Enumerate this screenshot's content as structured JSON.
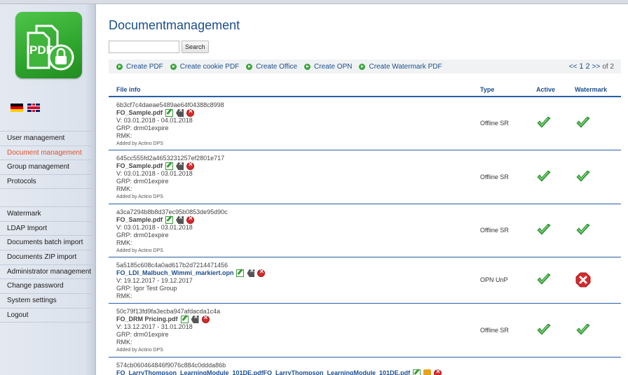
{
  "window": {
    "title": "Documentmanagement"
  },
  "sidebar": {
    "menu1": [
      {
        "label": "User management",
        "active": false
      },
      {
        "label": "Document management",
        "active": true
      },
      {
        "label": "Group management",
        "active": false
      },
      {
        "label": "Protocols",
        "active": false
      }
    ],
    "menu2": [
      {
        "label": "Watermark"
      },
      {
        "label": "LDAP Import"
      },
      {
        "label": "Documents batch import"
      },
      {
        "label": "Documents ZIP import"
      },
      {
        "label": "Administrator management"
      },
      {
        "label": "Change password"
      },
      {
        "label": "System settings"
      },
      {
        "label": "Logout"
      }
    ],
    "logo_text": "PDF"
  },
  "search": {
    "value": "",
    "button_label": "Search"
  },
  "actions": [
    {
      "label": "Create PDF"
    },
    {
      "label": "Create cookie PDF"
    },
    {
      "label": "Create Office"
    },
    {
      "label": "Create OPN"
    },
    {
      "label": "Create Watermark PDF"
    }
  ],
  "pager": {
    "prev": "<<",
    "pages": [
      "1",
      "2"
    ],
    "next": ">>",
    "of": "of 2"
  },
  "table": {
    "headers": {
      "info": "File info",
      "type": "Type",
      "active": "Active",
      "watermark": "Watermark"
    },
    "rows": [
      {
        "hash": "6b3cf7c4daeae5489ae64f04388c8998",
        "filename": "FO_Sample.pdf",
        "validity": "V: 03.01.2018 - 04.01.2018",
        "group": "GRP: drm01expire",
        "remark": "RMK:",
        "added": "Added by Actino DPS",
        "type": "Offline SR",
        "active": true,
        "watermark": true
      },
      {
        "hash": "645cc555fd2a4653231257ef2801e717",
        "filename": "FO_Sample.pdf",
        "validity": "V: 03.01.2018 - 03.01.2018",
        "group": "GRP: drm01expire",
        "remark": "RMK:",
        "added": "Added by Actino DPS",
        "type": "Offline SR",
        "active": true,
        "watermark": true
      },
      {
        "hash": "a3ca7294b8b8d37ec95b0853de95d90c",
        "filename": "FO_Sample.pdf",
        "validity": "V: 03.01.2018 - 03.01.2018",
        "group": "GRP: drm01expire",
        "remark": "RMK:",
        "added": "Added by Actino DPS",
        "type": "Offline SR",
        "active": true,
        "watermark": true
      },
      {
        "hash": "5a5185c608c4a0ad617b2d7214471456",
        "filename": "FO_LDI_Malbuch_Wimmi_markiert.opn",
        "validity": "V: 19.12.2017 - 19.12.2017",
        "group": "GRP: Igor Test Group",
        "remark": "RMK:",
        "added": "",
        "type": "OPN UnP",
        "active": true,
        "watermark": false
      },
      {
        "hash": "50c79f13fd9fa3ecba947afdacda1c4a",
        "filename": "FO_DRM Pricing.pdf",
        "validity": "V: 13.12.2017 - 31.01.2018",
        "group": "GRP: drm01expire",
        "remark": "RMK:",
        "added": "Added by Actino DPS",
        "type": "Offline SR",
        "active": true,
        "watermark": true
      },
      {
        "hash": "574cb060464846f9076c884c0ddda86b",
        "filename": "FO_LarryThompson_LearningModule_101DE.pdfFO_LarryThompson_LearningModule_101DE.pdf",
        "validity": "",
        "group": "",
        "remark": "",
        "added": "",
        "type": "",
        "active": null,
        "watermark": null
      }
    ]
  },
  "colors": {
    "accent": "#1c4e8c",
    "active_menu": "#e0502d",
    "check_green": "#3aa53a",
    "error_red": "#d62a2a"
  }
}
